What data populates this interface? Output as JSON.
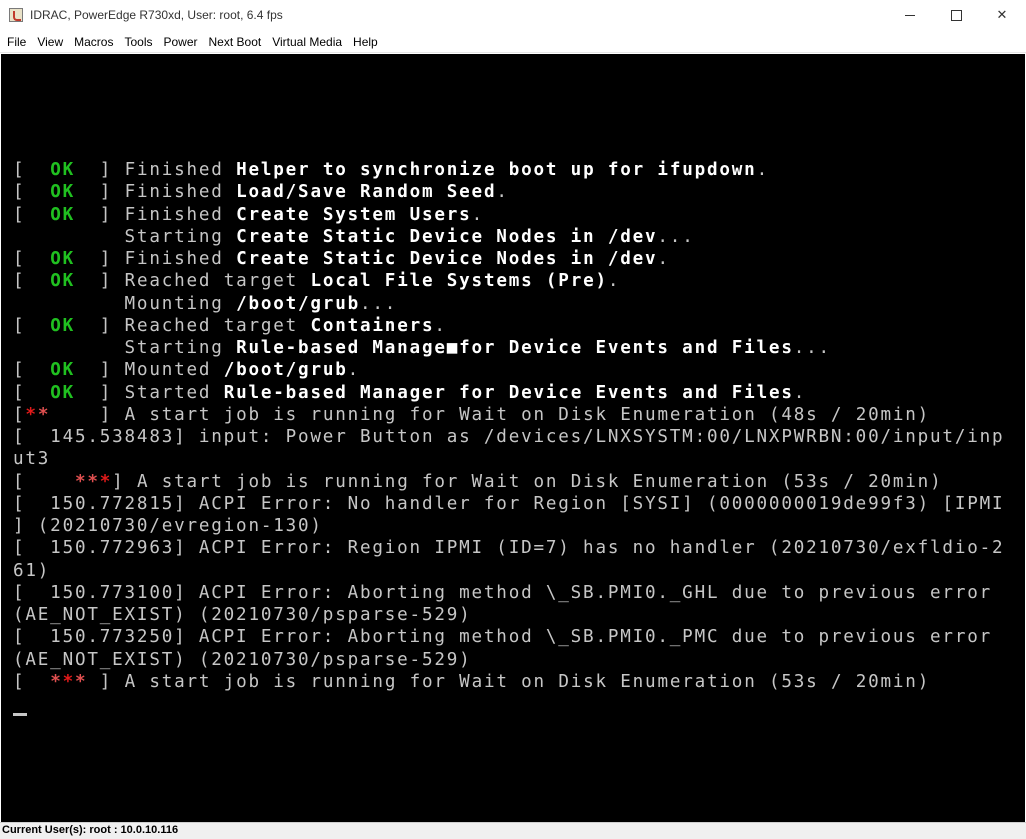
{
  "window": {
    "title": "IDRAC, PowerEdge R730xd, User: root, 6.4 fps",
    "minimize_glyph": "",
    "maximize_glyph": "",
    "close_glyph": "✕"
  },
  "menu": [
    "File",
    "View",
    "Macros",
    "Tools",
    "Power",
    "Next Boot",
    "Virtual Media",
    "Help"
  ],
  "console": {
    "lines": [
      [
        {
          "t": "[  "
        },
        {
          "t": "OK",
          "c": "ok"
        },
        {
          "t": "  ] "
        },
        {
          "t": "Finished "
        },
        {
          "t": "Helper to synchronize boot up for ifupdown",
          "c": "b"
        },
        {
          "t": "."
        }
      ],
      [
        {
          "t": "[  "
        },
        {
          "t": "OK",
          "c": "ok"
        },
        {
          "t": "  ] "
        },
        {
          "t": "Finished "
        },
        {
          "t": "Load/Save Random Seed",
          "c": "b"
        },
        {
          "t": "."
        }
      ],
      [
        {
          "t": "[  "
        },
        {
          "t": "OK",
          "c": "ok"
        },
        {
          "t": "  ] "
        },
        {
          "t": "Finished "
        },
        {
          "t": "Create System Users",
          "c": "b"
        },
        {
          "t": "."
        }
      ],
      [
        {
          "t": "         Starting "
        },
        {
          "t": "Create Static Device Nodes in /dev",
          "c": "b"
        },
        {
          "t": "..."
        }
      ],
      [
        {
          "t": "[  "
        },
        {
          "t": "OK",
          "c": "ok"
        },
        {
          "t": "  ] "
        },
        {
          "t": "Finished "
        },
        {
          "t": "Create Static Device Nodes in /dev",
          "c": "b"
        },
        {
          "t": "."
        }
      ],
      [
        {
          "t": "[  "
        },
        {
          "t": "OK",
          "c": "ok"
        },
        {
          "t": "  ] "
        },
        {
          "t": "Reached target "
        },
        {
          "t": "Local File Systems (Pre)",
          "c": "b"
        },
        {
          "t": "."
        }
      ],
      [
        {
          "t": "         Mounting "
        },
        {
          "t": "/boot/grub",
          "c": "b"
        },
        {
          "t": "..."
        }
      ],
      [
        {
          "t": "[  "
        },
        {
          "t": "OK",
          "c": "ok"
        },
        {
          "t": "  ] "
        },
        {
          "t": "Reached target "
        },
        {
          "t": "Containers",
          "c": "b"
        },
        {
          "t": "."
        }
      ],
      [
        {
          "t": "         Starting "
        },
        {
          "t": "Rule-based Manage■for Device Events and Files",
          "c": "b"
        },
        {
          "t": "..."
        }
      ],
      [
        {
          "t": "[  "
        },
        {
          "t": "OK",
          "c": "ok"
        },
        {
          "t": "  ] "
        },
        {
          "t": "Mounted "
        },
        {
          "t": "/boot/grub",
          "c": "b"
        },
        {
          "t": "."
        }
      ],
      [
        {
          "t": "[  "
        },
        {
          "t": "OK",
          "c": "ok"
        },
        {
          "t": "  ] "
        },
        {
          "t": "Started "
        },
        {
          "t": "Rule-based Manager for Device Events and Files",
          "c": "b"
        },
        {
          "t": "."
        }
      ],
      [
        {
          "t": "["
        },
        {
          "t": "*",
          "c": "red"
        },
        {
          "t": "*",
          "c": "dim"
        },
        {
          "t": "    ] A start job is running for Wait on Disk Enumeration (48s / 20min)"
        }
      ],
      [
        {
          "t": "[  145.538483] input: Power Button as /devices/LNXSYSTM:00/LNXPWRBN:00/input/inp"
        }
      ],
      [
        {
          "t": "ut3"
        }
      ],
      [
        {
          "t": "[    "
        },
        {
          "t": "**",
          "c": "dim"
        },
        {
          "t": "*",
          "c": "red"
        },
        {
          "t": "] A start job is running for Wait on Disk Enumeration (53s / 20min)"
        }
      ],
      [
        {
          "t": "[  150.772815] ACPI Error: No handler for Region [SYSI] (0000000019de99f3) [IPMI"
        }
      ],
      [
        {
          "t": "] (20210730/evregion-130)"
        }
      ],
      [
        {
          "t": "[  150.772963] ACPI Error: Region IPMI (ID=7) has no handler (20210730/exfldio-2"
        }
      ],
      [
        {
          "t": "61)"
        }
      ],
      [
        {
          "t": "[  150.773100] ACPI Error: Aborting method \\_SB.PMI0._GHL due to previous error"
        }
      ],
      [
        {
          "t": "(AE_NOT_EXIST) (20210730/psparse-529)"
        }
      ],
      [
        {
          "t": "[  150.773250] ACPI Error: Aborting method \\_SB.PMI0._PMC due to previous error"
        }
      ],
      [
        {
          "t": "(AE_NOT_EXIST) (20210730/psparse-529)"
        }
      ],
      [
        {
          "t": "[  "
        },
        {
          "t": "*",
          "c": "dim"
        },
        {
          "t": "*",
          "c": "red"
        },
        {
          "t": "* ",
          "c": "dim"
        },
        {
          "t": "] A start job is running for Wait on Disk Enumeration (53s / 20min)"
        }
      ]
    ],
    "colors": {
      "background": "#000000",
      "text": "#c6c6c6",
      "ok": "#20c020",
      "star": "#e21a1a"
    }
  },
  "status": {
    "text": "Current User(s): root : 10.0.10.116"
  }
}
